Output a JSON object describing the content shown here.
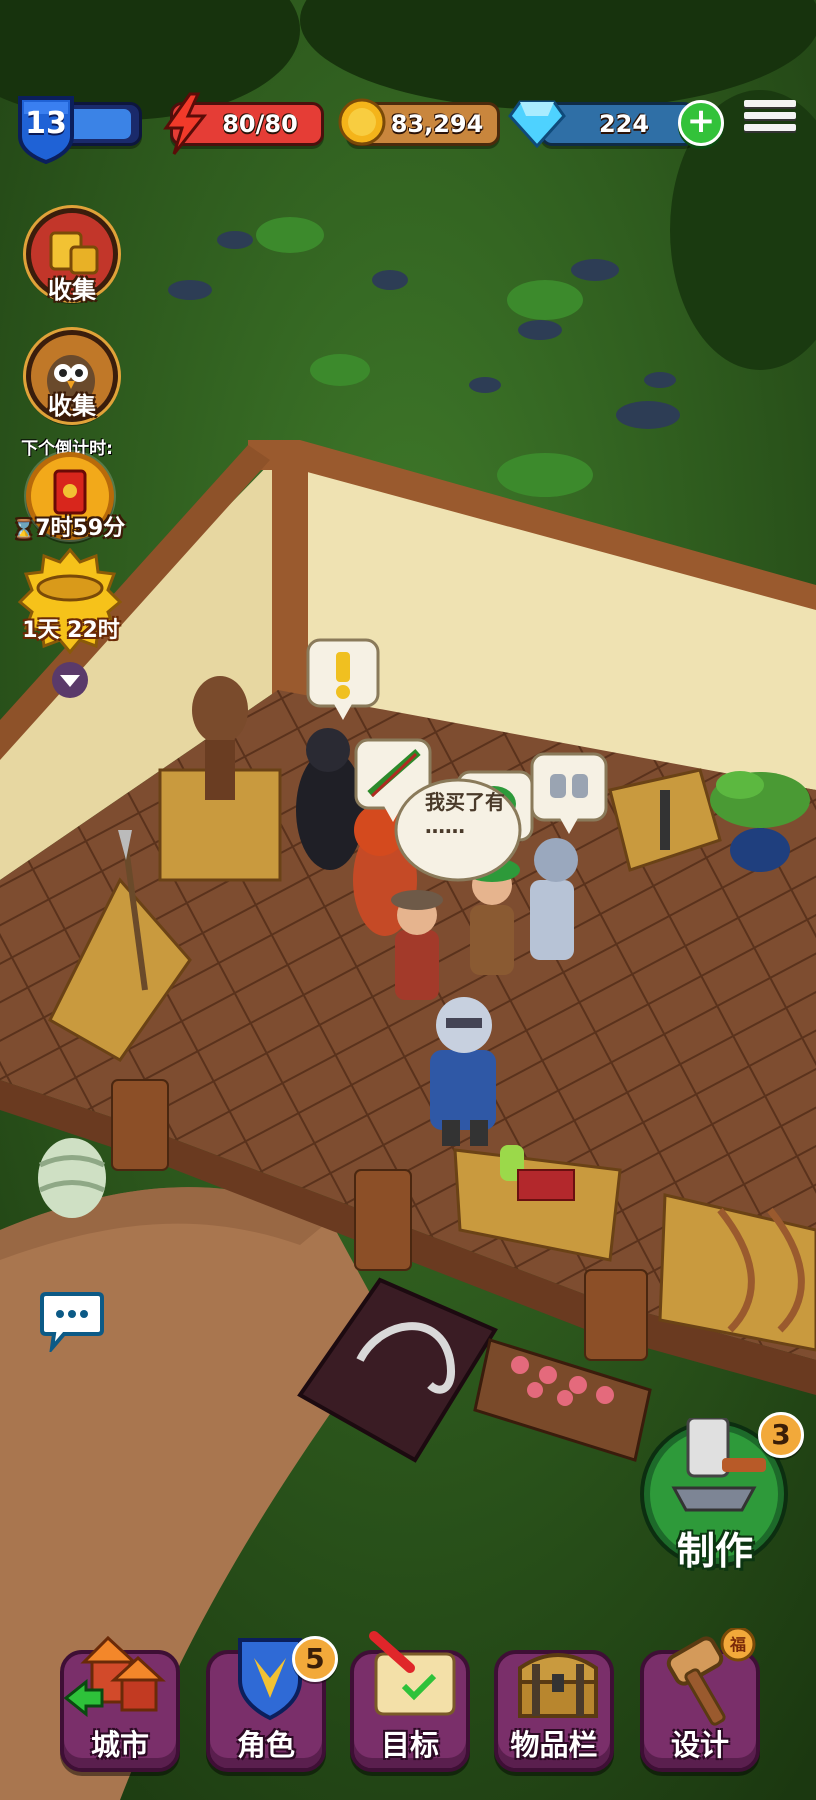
{
  "hud": {
    "level": "13",
    "xp_progress": 0.9,
    "energy": "80/80",
    "gold": "83,294",
    "gems": "224"
  },
  "left_column": {
    "collect_gold_label": "收集",
    "collect_owl_label": "收集",
    "next_countdown_title": "下个倒计时:",
    "next_countdown_time": "7时59分",
    "sale_timer": "1天 22时"
  },
  "scene": {
    "speech_bubble_text": "我买了有\n……",
    "alert_symbol": "!"
  },
  "craft": {
    "label": "制作",
    "badge_count": "3"
  },
  "bottom_nav": [
    {
      "label": "城市",
      "icon": "city-icon"
    },
    {
      "label": "角色",
      "icon": "hero-shield-icon",
      "badge": "5"
    },
    {
      "label": "目标",
      "icon": "quest-scroll-icon"
    },
    {
      "label": "物品栏",
      "icon": "treasure-chest-icon"
    },
    {
      "label": "设计",
      "icon": "hammer-icon"
    }
  ],
  "colors": {
    "grass": "#2f5a1f",
    "floor": "#7a4a2e",
    "wall": "#f1e6ba",
    "nav_tile": "#7a2f6a",
    "craft_green": "#2e9a3a"
  }
}
